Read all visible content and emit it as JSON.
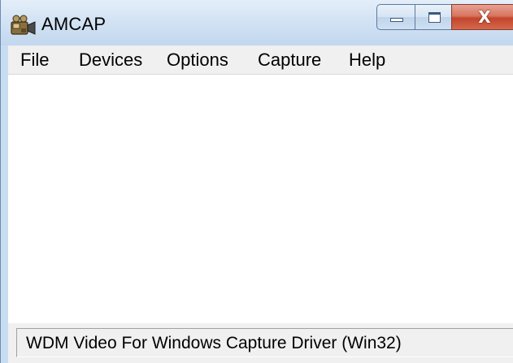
{
  "window": {
    "title": "AMCAP",
    "icon": "camera-icon",
    "caption_buttons": {
      "minimize_icon": "minimize-icon",
      "maximize_icon": "maximize-icon",
      "close_glyph": "X"
    }
  },
  "menu": {
    "items": [
      {
        "label": "File"
      },
      {
        "label": "Devices"
      },
      {
        "label": "Options"
      },
      {
        "label": "Capture"
      },
      {
        "label": "Help"
      }
    ]
  },
  "status_bar": {
    "text": "WDM Video For Windows Capture Driver (Win32)"
  },
  "colors": {
    "titlebar": "#d3e3f4",
    "close_button": "#c3452b",
    "menubar": "#f0f0f0",
    "client": "#ffffff"
  }
}
